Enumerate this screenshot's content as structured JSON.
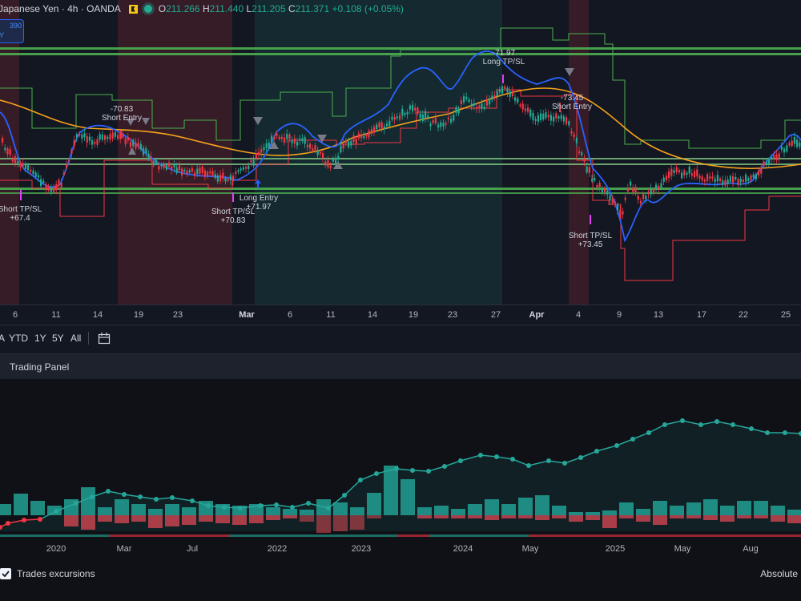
{
  "header": {
    "symbol": "Japanese Yen · 4h · OANDA",
    "open_label": "O",
    "open": "211.266",
    "high_label": "H",
    "high": "211.440",
    "low_label": "L",
    "low": "211.205",
    "close_label": "C",
    "close": "211.371",
    "change": "+0.108 (+0.05%)"
  },
  "badge": {
    "line1": "390",
    "line2": "Y"
  },
  "x_axis": [
    "6",
    "11",
    "14",
    "19",
    "23",
    "Mar",
    "6",
    "11",
    "14",
    "19",
    "23",
    "27",
    "Apr",
    "4",
    "9",
    "13",
    "17",
    "22",
    "25"
  ],
  "annotations": {
    "a1_val": "-70.83",
    "a1_lbl": "Short Entry",
    "a2_lbl": "Short TP/SL",
    "a2_val": "+67.4",
    "a3_lbl": "Short TP/SL",
    "a3_val": "+70.83",
    "a4_lbl": "Long Entry",
    "a4_val": "+71.97",
    "a5_val": "-71.97",
    "a5_lbl": "Long TP/SL",
    "a6_val": "-73.45",
    "a6_lbl": "Short Entry",
    "a7_lbl": "Short TP/SL",
    "a7_val": "+73.45"
  },
  "toolbar": {
    "r1": "A",
    "r2": "YTD",
    "r3": "1Y",
    "r4": "5Y",
    "r5": "All"
  },
  "panel": {
    "title": "Trading Panel",
    "checkbox_label": "Trades excursions",
    "mode": "Absolute"
  },
  "bottom_axis": [
    "2020",
    "Mar",
    "Jul",
    "2022",
    "2023",
    "2024",
    "May",
    "2025",
    "May",
    "Aug"
  ],
  "colors": {
    "up": "#22ab94",
    "down": "#f23645",
    "ema": "#f7a21b",
    "blue": "#2962ff",
    "green_line": "#4caf50",
    "equity": "#26a69a"
  }
}
